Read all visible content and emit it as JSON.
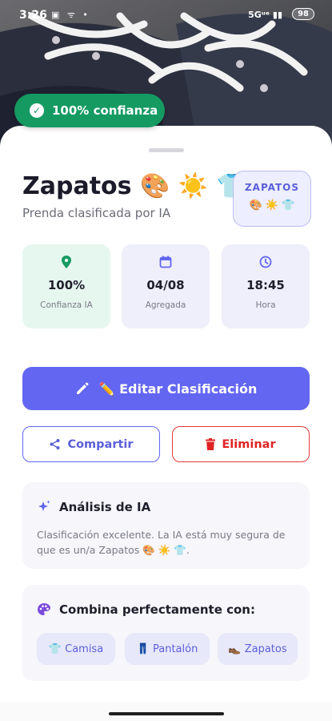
{
  "status_bar": {
    "time": "3:26",
    "left_icons": "▣ ᯤ •",
    "network": "5Gᵘᵉ ▮▮",
    "battery": "98"
  },
  "confidence_badge": {
    "label": "100% confianza"
  },
  "item": {
    "title": "Zapatos 🎨 ☀️ 👕",
    "subtitle": "Prenda clasificada por IA",
    "tag_label": "ZAPATOS",
    "tag_emojis": "🎨 ☀️ 👕"
  },
  "stats": [
    {
      "value": "100%",
      "label": "Confianza IA",
      "icon": "location-pin-icon"
    },
    {
      "value": "04/08",
      "label": "Agregada",
      "icon": "calendar-icon"
    },
    {
      "value": "18:45",
      "label": "Hora",
      "icon": "clock-icon"
    }
  ],
  "actions": {
    "edit_label": "✏️ Editar Clasificación",
    "share_label": "Compartir",
    "delete_label": "Eliminar"
  },
  "analysis": {
    "heading": "Análisis de IA",
    "text": "Clasificación excelente. La IA está muy segura de que es un/a Zapatos 🎨 ☀️ 👕."
  },
  "combine": {
    "heading": "Combina perfectamente con:",
    "chips": [
      "👕 Camisa",
      "👖 Pantalón",
      "👞 Zapatos"
    ]
  },
  "colors": {
    "accent": "#6366f1",
    "success": "#159a62",
    "danger": "#e02424"
  }
}
